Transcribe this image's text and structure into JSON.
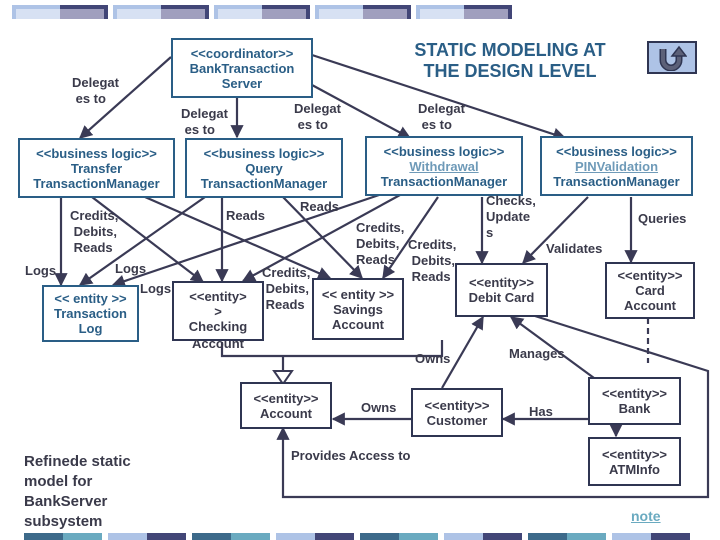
{
  "slide": {
    "title_line1": "STATIC MODELING AT",
    "title_line2": "THE DESIGN LEVEL",
    "return_icon": "u-turn-return-icon",
    "caption": [
      "Refinede static",
      "model for",
      "BankServer",
      "subsystem"
    ],
    "note_link": "note"
  },
  "colors": {
    "band_light": "#aec3e6",
    "band_dark": "#424677",
    "band_teal": "#6aaac0",
    "band_steel": "#3d6a8a",
    "title_blue": "#2a5e86",
    "box_border_dark": "#2f3552",
    "link_blue": "#6e9ab8"
  },
  "boxes": {
    "coordinator": {
      "stereotype": "<<coordinator>>",
      "name1": "BankTransaction",
      "name2": "Server"
    },
    "transfer": {
      "stereotype": "<<business logic>>",
      "name1": "Transfer",
      "name2": "TransactionManager"
    },
    "query": {
      "stereotype": "<<business logic>>",
      "name1": "Query",
      "name2": "TransactionManager"
    },
    "withdrawal": {
      "stereotype": "<<business logic>>",
      "name1": "Withdrawal",
      "name2": "TransactionManager"
    },
    "pinvalidation": {
      "stereotype": "<<business logic>>",
      "name1": "PINValidation",
      "name2": "TransactionManager"
    },
    "transaction_log": {
      "stereotype": "<< entity >>",
      "name1": "Transaction",
      "name2": "Log"
    },
    "checking_account": {
      "stereotype": "<<entity>",
      "name1": ">",
      "name2": "Checking",
      "name3": "Account"
    },
    "savings_account": {
      "stereotype": "<< entity >>",
      "name1": "Savings",
      "name2": "Account"
    },
    "debit_card": {
      "stereotype": "<<entity>>",
      "name1": "Debit Card"
    },
    "card_account": {
      "stereotype": "<<entity>>",
      "name1": "Card",
      "name2": "Account"
    },
    "account": {
      "stereotype": "<<entity>>",
      "name1": "Account"
    },
    "customer": {
      "stereotype": "<<entity>>",
      "name1": "Customer"
    },
    "bank": {
      "stereotype": "<<entity>>",
      "name1": "Bank"
    },
    "atminfo": {
      "stereotype": "<<entity>>",
      "name1": "ATMInfo"
    }
  },
  "labels": {
    "delegates_transfer": "Delegat\n es to",
    "delegates_query": "Delegat\n es to",
    "delegates_withdrawal": "Delegat\n es to",
    "delegates_pin": "Delegat\n es to",
    "transfer_cdr": "Credits,\n Debits,\n Reads",
    "transfer_logs": "Logs",
    "query_logs": "Logs",
    "withdrawal_logs": "Logs",
    "query_reads_checking": "Reads",
    "query_reads_savings": "Reads",
    "withdrawal_cdr_savings": "Credits,\nDebits,\nReads",
    "withdrawal_cdr_checking": "Credits,\n Debits,\n Reads",
    "transfer_cdr_savings": "Credits,\n Debits,\n Reads",
    "checks_updates": "Checks,\nUpdate\ns",
    "validates": "Validates",
    "queries": "Queries",
    "owns_debit": "Owns",
    "manages": "Manages",
    "owns_account": "Owns",
    "has": "Has",
    "provides_access": "Provides Access to"
  }
}
